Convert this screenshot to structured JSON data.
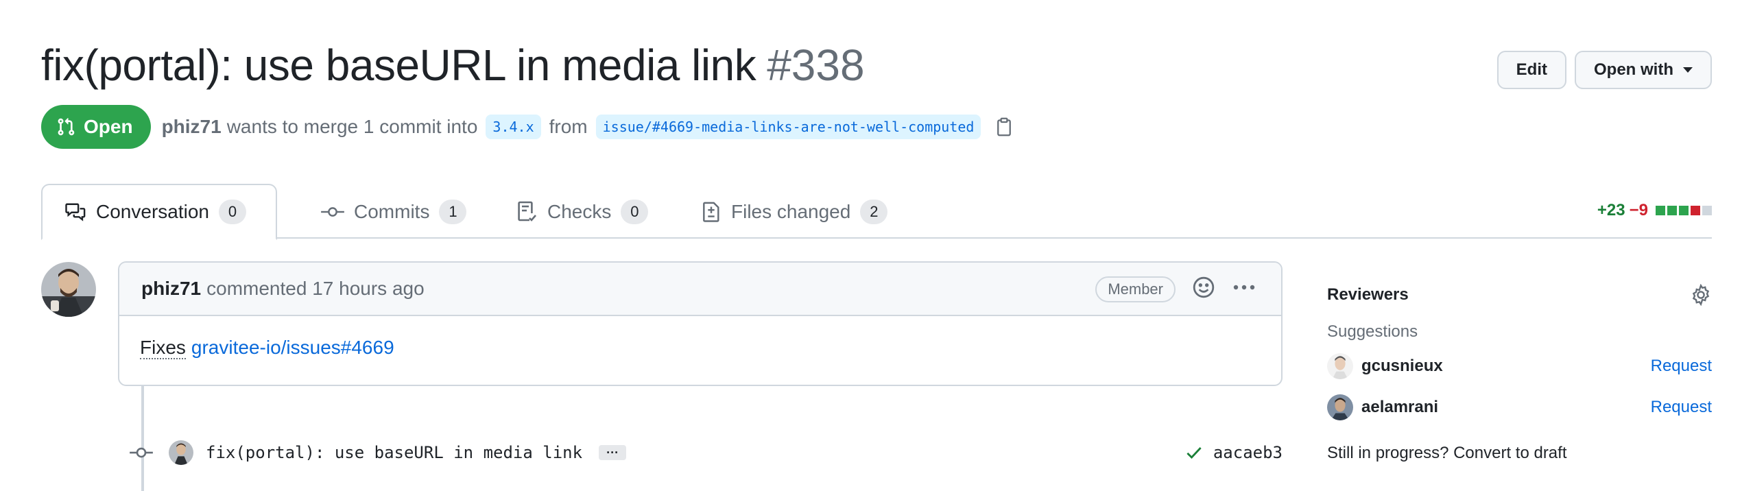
{
  "header": {
    "title": "fix(portal): use baseURL in media link",
    "number": "#338",
    "edit_label": "Edit",
    "open_with_label": "Open with"
  },
  "meta": {
    "state": "Open",
    "author": "phiz71",
    "merge_text": "wants to merge 1 commit into",
    "base_branch": "3.4.x",
    "from_text": "from",
    "head_branch": "issue/#4669-media-links-are-not-well-computed"
  },
  "tabs": [
    {
      "label": "Conversation",
      "count": "0"
    },
    {
      "label": "Commits",
      "count": "1"
    },
    {
      "label": "Checks",
      "count": "0"
    },
    {
      "label": "Files changed",
      "count": "2"
    }
  ],
  "diffstat": {
    "additions": "+23",
    "deletions": "−9",
    "blocks": [
      "#2da44e",
      "#2da44e",
      "#2da44e",
      "#cf222e",
      "#d0d7de"
    ]
  },
  "comment": {
    "author": "phiz71",
    "action": "commented 17 hours ago",
    "badge": "Member",
    "body_prefix": "Fixes",
    "body_link": "gravitee-io/issues#4669"
  },
  "commit": {
    "message": "fix(portal): use baseURL in media link",
    "ellipsis": "···",
    "sha": "aacaeb3"
  },
  "sidebar": {
    "reviewers_heading": "Reviewers",
    "suggestions_label": "Suggestions",
    "reviewers": [
      {
        "name": "gcusnieux",
        "action": "Request"
      },
      {
        "name": "aelamrani",
        "action": "Request"
      }
    ],
    "draft_note": "Still in progress? Convert to draft"
  },
  "colors": {
    "open_green": "#2da44e",
    "link_blue": "#0969da",
    "border": "#d0d7de"
  },
  "icons": {
    "state": "git-pull-request-icon",
    "copy": "copy-icon",
    "conversation": "comment-discussion-icon",
    "commits": "git-commit-icon",
    "checks": "checklist-icon",
    "files": "file-diff-icon",
    "emoji": "smiley-icon",
    "more": "kebab-horizontal-icon",
    "check": "check-icon",
    "settings": "gear-icon"
  }
}
